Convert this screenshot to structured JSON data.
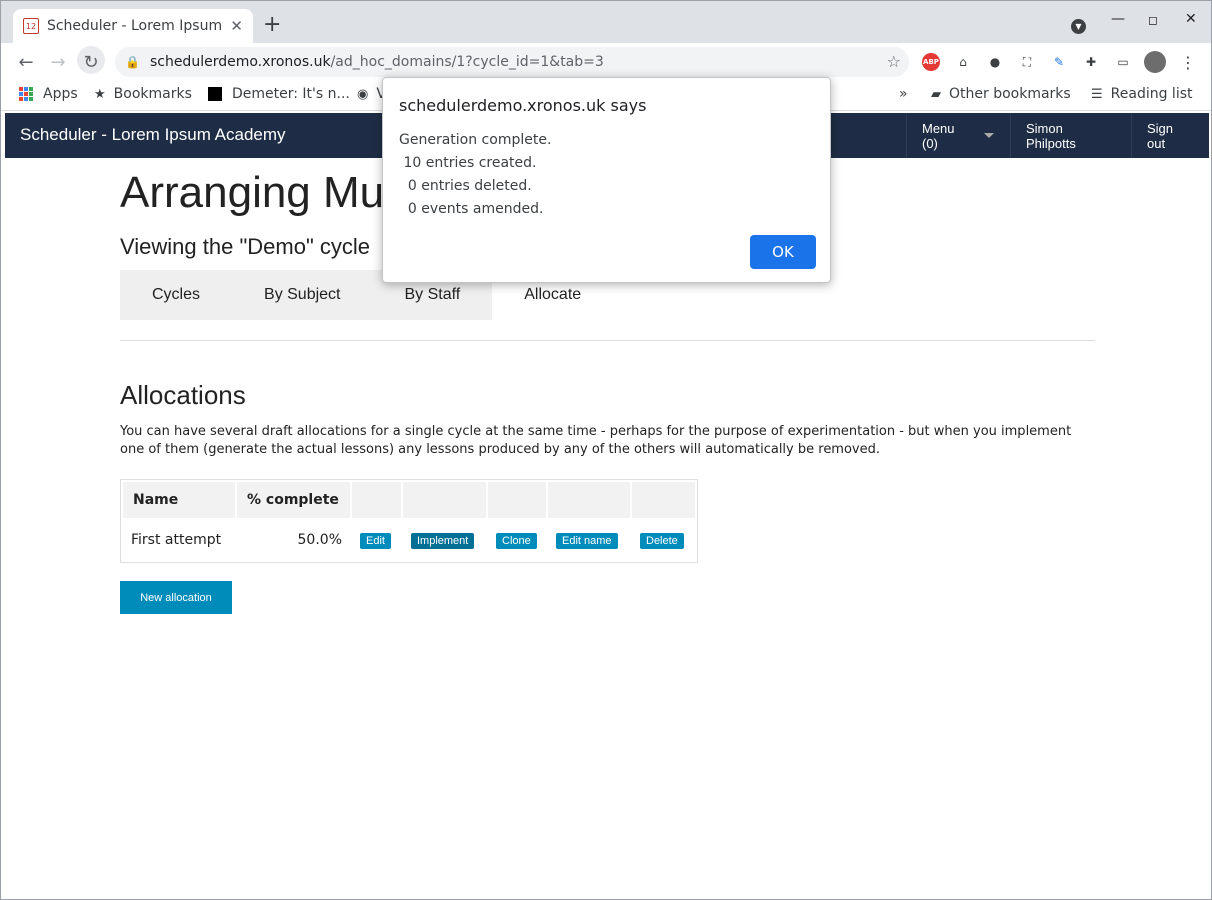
{
  "browser": {
    "tab_title": "Scheduler - Lorem Ipsum Academy",
    "favicon_text": "12",
    "url_host": "schedulerdemo.xronos.uk",
    "url_path": "/ad_hoc_domains/1?cycle_id=1&tab=3",
    "abp_label": "ABP",
    "bookmarks": [
      "Apps",
      "Bookmarks",
      "Demeter: It's n...",
      "V"
    ],
    "bookmarks_overflow": "»",
    "other_bookmarks": "Other bookmarks",
    "reading_list": "Reading list"
  },
  "app": {
    "brand": "Scheduler - Lorem Ipsum Academy",
    "menu_label": "Menu (0)",
    "user_name": "Simon Philpotts",
    "sign_out": "Sign out"
  },
  "page": {
    "title": "Arranging Mu",
    "subtitle": "Viewing the \"Demo\" cycle",
    "tabs": [
      "Cycles",
      "By Subject",
      "By Staff",
      "Allocate"
    ],
    "section_title": "Allocations",
    "description": "You can have several draft allocations for a single cycle at the same time - perhaps for the purpose of experimentation - but when you implement one of them (generate the actual lessons) any lessons produced by any of the others will automatically be removed.",
    "table": {
      "headers": [
        "Name",
        "% complete"
      ],
      "row": {
        "name": "First attempt",
        "complete": "50.0%",
        "actions": [
          "Edit",
          "Implement",
          "Clone",
          "Edit name",
          "Delete"
        ]
      }
    },
    "new_allocation": "New allocation"
  },
  "dialog": {
    "title": "schedulerdemo.xronos.uk says",
    "message": "Generation complete.\n 10 entries created.\n  0 entries deleted.\n  0 events amended.",
    "ok_label": "OK"
  }
}
